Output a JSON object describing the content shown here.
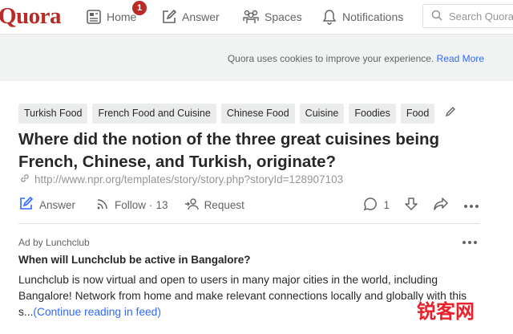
{
  "header": {
    "logo": "Quora",
    "nav": [
      {
        "label": "Home",
        "badge": "1",
        "icon": "home-icon"
      },
      {
        "label": "Answer",
        "icon": "pencil-square-icon"
      },
      {
        "label": "Spaces",
        "icon": "people-icon"
      },
      {
        "label": "Notifications",
        "icon": "bell-icon"
      }
    ],
    "search_placeholder": "Search Quora"
  },
  "cookie_banner": {
    "text": "Quora uses cookies to improve your experience.",
    "link": "Read More"
  },
  "question": {
    "tags": [
      "Turkish Food",
      "French Food and Cuisine",
      "Chinese Food",
      "Cuisine",
      "Foodies",
      "Food"
    ],
    "title": "Where did the notion of the three great cuisines being French, Chinese, and Turkish, originate?",
    "source_url": "http://www.npr.org/templates/story/story.php?storyId=128907103",
    "actions": {
      "answer": "Answer",
      "follow": "Follow",
      "follow_count": "13",
      "request": "Request",
      "comment_count": "1"
    }
  },
  "ad": {
    "label": "Ad by Lunchclub",
    "title": "When will Lunchclub be active in Bangalore?",
    "body": "Lunchclub is now virtual and open to users in many major cities in the world, including Bangalore! Network from home and make relevant connections locally and globally with this s...",
    "continue": "(Continue reading in feed)"
  },
  "watermark": "锐客网",
  "colors": {
    "brand": "#b92b27",
    "link": "#2e69ff",
    "muted": "#636466",
    "banner_bg": "#f1f2f2"
  }
}
